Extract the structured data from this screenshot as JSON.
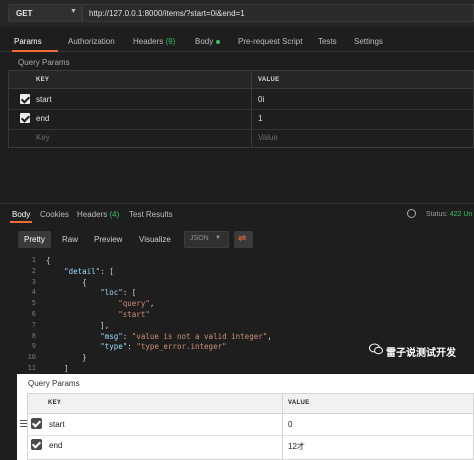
{
  "request": {
    "method": "GET",
    "url": "http://127.0.0.1:8000/items/?start=0i&end=1"
  },
  "request_tabs": {
    "params": "Params",
    "authorization": "Authorization",
    "headers": "Headers",
    "headers_count": "(9)",
    "body": "Body",
    "pre_request": "Pre-request Script",
    "tests": "Tests",
    "settings": "Settings"
  },
  "query_params": {
    "label": "Query Params",
    "key_header": "KEY",
    "value_header": "VALUE",
    "rows": [
      {
        "key": "start",
        "value": "0i",
        "checked": true
      },
      {
        "key": "end",
        "value": "1",
        "checked": true
      }
    ],
    "key_placeholder": "Key",
    "value_placeholder": "Value"
  },
  "response": {
    "tabs": {
      "body": "Body",
      "cookies": "Cookies",
      "headers": "Headers",
      "headers_count": "(4)",
      "test_results": "Test Results"
    },
    "status_label": "Status:",
    "status_value": "422 Un",
    "view_buttons": {
      "pretty": "Pretty",
      "raw": "Raw",
      "preview": "Preview",
      "visualize": "Visualize"
    },
    "format": "JSON",
    "code_lines": [
      {
        "n": "1",
        "text": "{"
      },
      {
        "n": "2",
        "text": "    \"detail\": ["
      },
      {
        "n": "3",
        "text": "        {"
      },
      {
        "n": "4",
        "text": "            \"loc\": ["
      },
      {
        "n": "5",
        "text": "                \"query\","
      },
      {
        "n": "6",
        "text": "                \"start\""
      },
      {
        "n": "7",
        "text": "            ],"
      },
      {
        "n": "8",
        "text": "            \"msg\": \"value is not a valid integer\","
      },
      {
        "n": "9",
        "text": "            \"type\": \"type_error.integer\""
      },
      {
        "n": "10",
        "text": "        }"
      },
      {
        "n": "11",
        "text": "    ]"
      }
    ]
  },
  "watermark": {
    "text": "雷子说测试开发",
    "icon": "wechat-icon"
  },
  "overlay": {
    "label": "Query Params",
    "key_header": "KEY",
    "value_header": "VALUE",
    "rows": [
      {
        "key": "start",
        "value": "0",
        "checked": true
      },
      {
        "key": "end",
        "value": "12才",
        "checked": true
      }
    ]
  },
  "colors": {
    "accent": "#f26b3a",
    "success": "#39c167",
    "background": "#1e1e1e"
  }
}
